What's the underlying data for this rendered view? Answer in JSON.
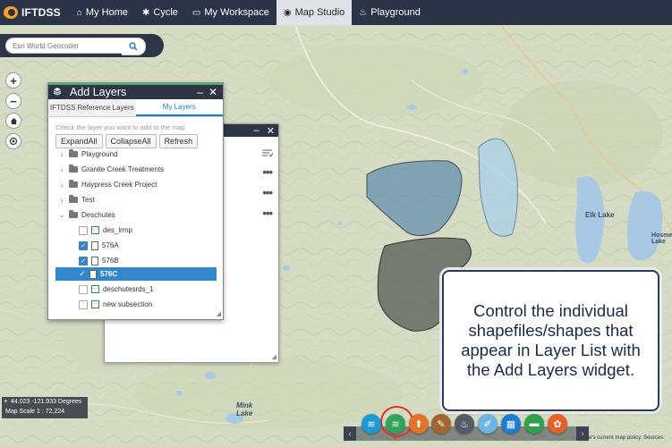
{
  "app": {
    "logo_text": "IFTDSS",
    "nav": [
      {
        "label": "My Home",
        "icon": "home-icon",
        "glyph": "⌂",
        "active": false
      },
      {
        "label": "Cycle",
        "icon": "gear-icon",
        "glyph": "✱",
        "active": false
      },
      {
        "label": "My Workspace",
        "icon": "window-icon",
        "glyph": "▭",
        "active": false
      },
      {
        "label": "Map Studio",
        "icon": "globe-icon",
        "glyph": "◉",
        "active": true
      },
      {
        "label": "Playground",
        "icon": "flame-icon",
        "glyph": "♨",
        "active": false
      }
    ]
  },
  "search": {
    "placeholder": "Esri World Geocoder",
    "button_icon": "search-icon"
  },
  "map_controls": {
    "zoom_in": "+",
    "zoom_out": "−",
    "home_icon": "home-icon",
    "locate_icon": "locate-icon"
  },
  "add_layers": {
    "title": "Add Layers",
    "minimize": "–",
    "close": "✕",
    "tabs": [
      {
        "label": "IFTDSS Reference Layers",
        "active": false
      },
      {
        "label": "My Layers",
        "active": true
      }
    ],
    "instructions": "Check the layer you want to add to the map",
    "buttons": {
      "expand": "ExpandAll",
      "collapse": "CollapseAll",
      "refresh": "Refresh"
    },
    "tree": [
      {
        "label": "Playground",
        "type": "folder",
        "expanded": false
      },
      {
        "label": "Granite Creek Treatments",
        "type": "folder",
        "expanded": false
      },
      {
        "label": "Haypress Creek Project",
        "type": "folder",
        "expanded": false
      },
      {
        "label": "Test",
        "type": "folder",
        "expanded": false
      },
      {
        "label": "Deschutes",
        "type": "folder",
        "expanded": true
      },
      {
        "label": "des_lrmp",
        "type": "table",
        "checked": false
      },
      {
        "label": "576A",
        "type": "doc",
        "checked": true
      },
      {
        "label": "576B",
        "type": "doc",
        "checked": true
      },
      {
        "label": "576C",
        "type": "doc",
        "checked": true,
        "selected": true
      },
      {
        "label": "deschutesrds_1",
        "type": "table",
        "checked": false
      },
      {
        "label": "new subsection",
        "type": "table",
        "checked": false
      }
    ]
  },
  "layer_list": {
    "minimize": "–",
    "close": "✕",
    "filter_icon": "filter-icon",
    "more_label": "•••"
  },
  "callout": {
    "text": "Control the individual shapefiles/shapes that appear in Layer List with the Add Layers widget."
  },
  "coordinates": {
    "position": "44.023 -121.933 Degrees",
    "scale": "Map Scale 1 : 72,224"
  },
  "map_labels": {
    "elk_lake": "Elk Lake",
    "hosmer_lake": "Hosmer Lake",
    "mink_lake": "Mink Lake"
  },
  "toolbar": {
    "prev": "‹",
    "next": "›",
    "tools": [
      {
        "name": "layer-list-tool",
        "color": "#1d9ad6",
        "glyph": "≋"
      },
      {
        "name": "add-layers-tool",
        "color": "#2fa45a",
        "glyph": "≋"
      },
      {
        "name": "upload-tool",
        "color": "#e0742a",
        "glyph": "⬆"
      },
      {
        "name": "draw-tool",
        "color": "#a0662e",
        "glyph": "✎"
      },
      {
        "name": "fire-tool",
        "color": "#555a63",
        "glyph": "♨"
      },
      {
        "name": "edit-tool",
        "color": "#6cb6e0",
        "glyph": "✐"
      },
      {
        "name": "grid-tool",
        "color": "#1b7ed6",
        "glyph": "▦"
      },
      {
        "name": "measure-tool",
        "color": "#2ea14a",
        "glyph": "▬"
      },
      {
        "name": "analysis-tool",
        "color": "#e2622a",
        "glyph": "✿"
      }
    ]
  },
  "attribution": "e's current map policy. Sources:"
}
